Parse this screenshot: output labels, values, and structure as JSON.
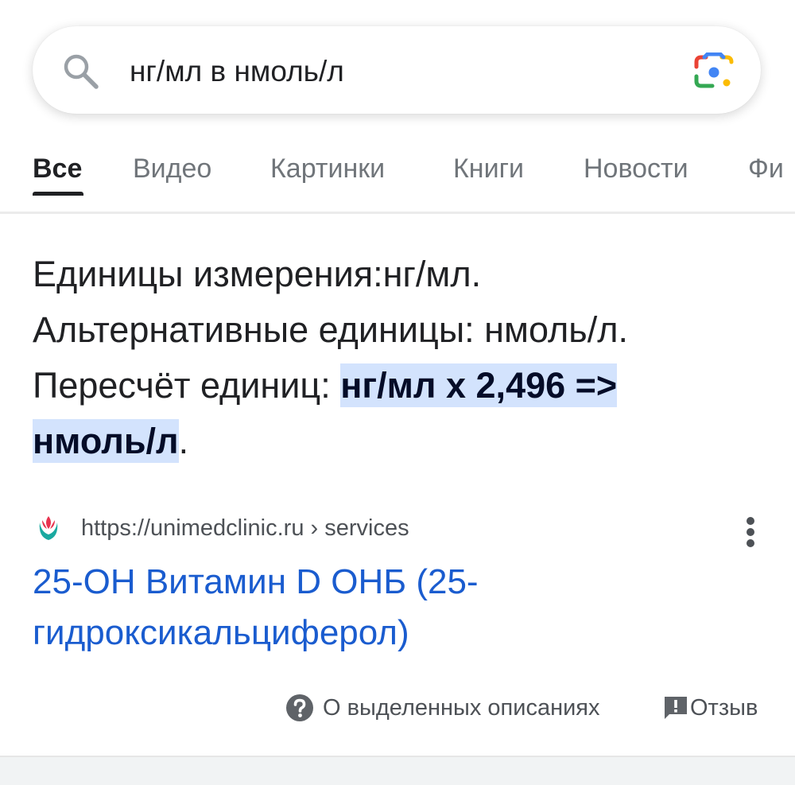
{
  "search": {
    "query": "нг/мл в нмоль/л"
  },
  "tabs": [
    {
      "label": "Все",
      "active": true
    },
    {
      "label": "Видео",
      "active": false
    },
    {
      "label": "Картинки",
      "active": false
    },
    {
      "label": "Книги",
      "active": false
    },
    {
      "label": "Новости",
      "active": false
    },
    {
      "label": "Фи",
      "active": false
    }
  ],
  "snippet": {
    "line1": "Единицы измерения:нг/мл.",
    "line2": "Альтернативные единицы: нмоль/л.",
    "line3_prefix": "Пересчёт единиц: ",
    "highlight_part1": "нг/мл х 2,496 =>",
    "highlight_part2": "нмоль/л",
    "line4_suffix": "."
  },
  "result": {
    "url": "https://unimedclinic.ru › services",
    "title_line1": "25-OH Витамин D ОНБ (25-",
    "title_line2": "гидроксикальциферол)"
  },
  "footer": {
    "about_label": "О выделенных описаниях",
    "feedback_label": "Отзыв"
  },
  "colors": {
    "highlight": "#d3e3fd",
    "link": "#1a5ccf",
    "tab_inactive": "#70757a"
  },
  "icons": {
    "search": "search-icon",
    "lens": "google-lens-icon",
    "favicon": "unimed-favicon-icon",
    "more": "more-vert-icon",
    "help": "help-circle-icon",
    "feedback": "feedback-icon"
  }
}
